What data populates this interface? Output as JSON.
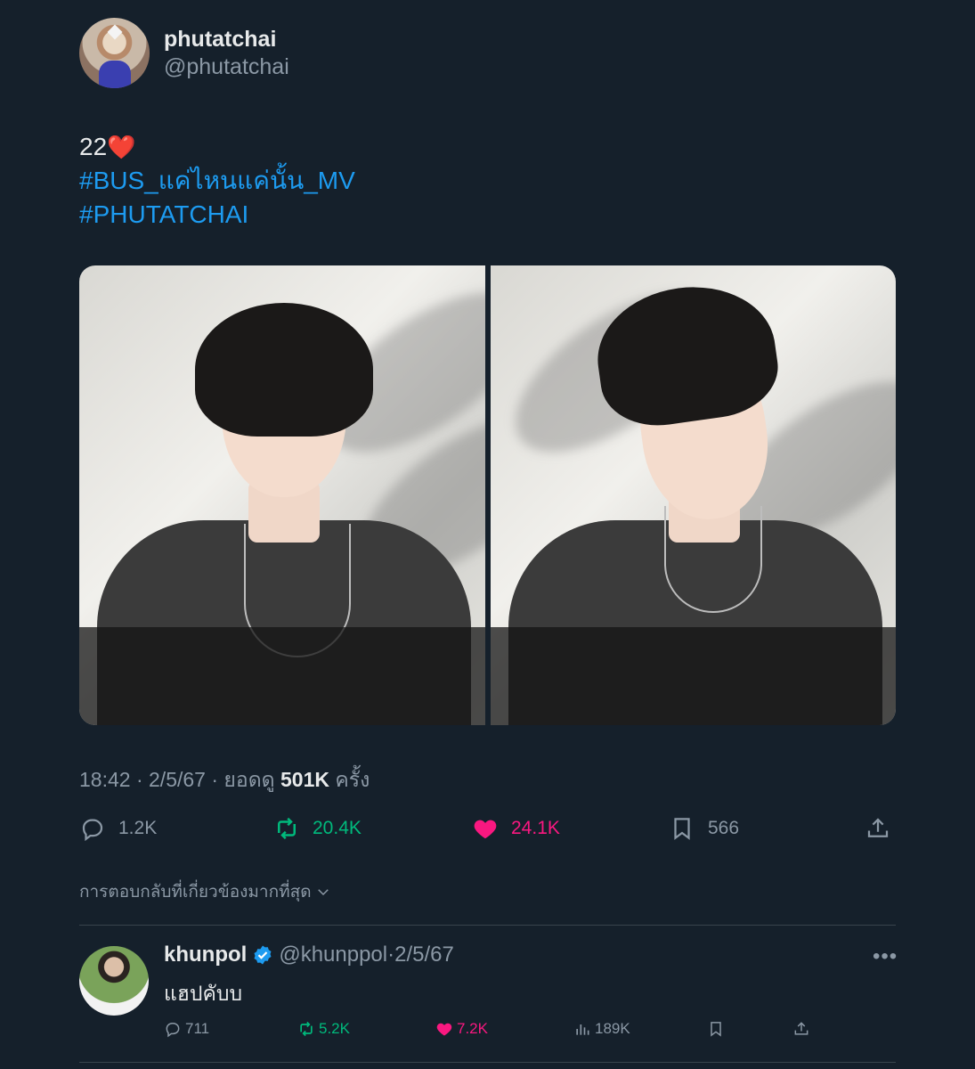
{
  "tweet": {
    "display_name": "phutatchai",
    "handle": "@phutatchai",
    "text_line1": "22",
    "text_emoji": "❤️",
    "hashtag1": "#BUS_แค่ไหนแค่นั้น_MV",
    "hashtag2": "#PHUTATCHAI",
    "time": "18:42",
    "date": "2/5/67",
    "views_prefix": "ยอดดู",
    "views_count": "501K",
    "views_suffix": "ครั้ง",
    "separator": "·"
  },
  "actions": {
    "replies": "1.2K",
    "retweets": "20.4K",
    "likes": "24.1K",
    "bookmarks": "566"
  },
  "sort_label": "การตอบกลับที่เกี่ยวข้องมากที่สุด",
  "reply": {
    "display_name": "khunpol",
    "handle": "@khunppol",
    "date": "2/5/67",
    "text": "แฮปคับบ",
    "replies": "711",
    "retweets": "5.2K",
    "likes": "7.2K",
    "views": "189K"
  },
  "colors": {
    "background": "#15202b",
    "accent": "#1d9bf0",
    "retweet": "#00ba7c",
    "like": "#f91880"
  }
}
